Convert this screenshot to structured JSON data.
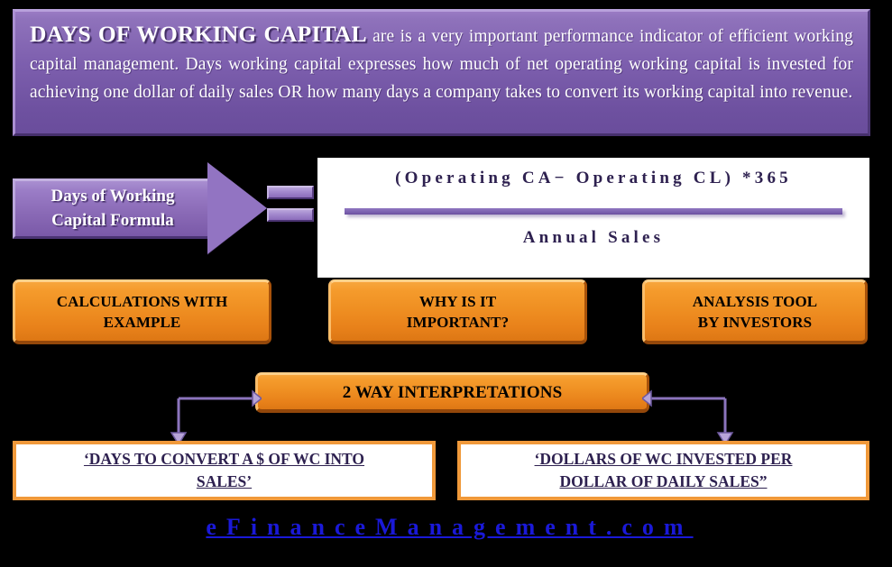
{
  "header": {
    "lead": "DAYS OF WORKING CAPITAL",
    "body": " are is a very important performance indicator of efficient working capital management. Days working capital expresses how much of net operating working capital is invested for achieving one dollar of daily sales OR how many days a company takes to convert its working capital into revenue."
  },
  "formula_arrow": {
    "label_line1": "Days of Working",
    "label_line2": "Capital Formula",
    "equals_symbol": "="
  },
  "formula": {
    "numerator": "(Operating CA− Operating CL) *365",
    "denominator": "Annual Sales"
  },
  "topic_boxes": [
    {
      "line1": "CALCULATIONS WITH",
      "line2": "EXAMPLE"
    },
    {
      "line1": "WHY IS IT",
      "line2": "IMPORTANT?"
    },
    {
      "line1": "ANALYSIS TOOL",
      "line2": "BY INVESTORS"
    }
  ],
  "interpretations": {
    "heading": "2 WAY INTERPRETATIONS",
    "left": {
      "line1": "‘DAYS TO CONVERT A $ OF WC INTO",
      "line2": "SALES’"
    },
    "right": {
      "line1": "‘DOLLARS OF WC INVESTED PER",
      "line2": "DOLLAR OF DAILY SALES”"
    }
  },
  "footer": {
    "brand": "eFinanceManagement.com"
  },
  "colors": {
    "background": "#000000",
    "header_purple": "#7d5fae",
    "arrow_purple": "#9274c2",
    "orange": "#ef8f22",
    "orange_border": "#f0993a",
    "navy_text": "#2e2150",
    "brand_blue": "#1a19d8",
    "connector_purple": "#8b74bd"
  }
}
